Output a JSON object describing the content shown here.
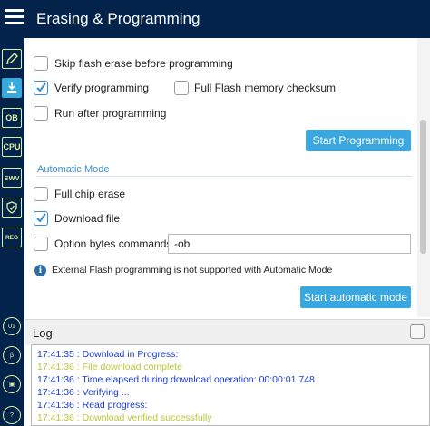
{
  "header": {
    "title": "Erasing & Programming"
  },
  "sidebar": {
    "buttons": [
      {
        "name": "edit",
        "label": ""
      },
      {
        "name": "download",
        "label": ""
      },
      {
        "name": "ob",
        "label": "OB"
      },
      {
        "name": "cpu",
        "label": "CPU"
      },
      {
        "name": "swv",
        "label": "SWV"
      },
      {
        "name": "security",
        "label": ""
      },
      {
        "name": "reg",
        "label": "REG"
      }
    ]
  },
  "options": {
    "skip_flash_erase": {
      "label": "Skip flash erase before programming",
      "checked": false
    },
    "verify_programming": {
      "label": "Verify programming",
      "checked": true
    },
    "full_flash_checksum": {
      "label": "Full Flash memory checksum",
      "checked": false
    },
    "run_after_programming": {
      "label": "Run after programming",
      "checked": false
    },
    "start_programming": "Start Programming"
  },
  "automatic_mode": {
    "title": "Automatic Mode",
    "full_chip_erase": {
      "label": "Full chip erase",
      "checked": false
    },
    "download_file": {
      "label": "Download file",
      "checked": true
    },
    "option_bytes": {
      "label": "Option bytes commands",
      "checked": false,
      "value": "-ob"
    },
    "info_text": "External Flash programming is not supported with Automatic Mode",
    "start_automatic": "Start automatic mode"
  },
  "log": {
    "title": "Log",
    "lines": [
      {
        "text": "17:41:35 : Download in Progress:",
        "color": "#1a3ccf"
      },
      {
        "text": "17:41:36 : File download complete",
        "color": "#b8c83a"
      },
      {
        "text": "17:41:36 : Time elapsed during download operation: 00:00:01.748",
        "color": "#1a3ccf"
      },
      {
        "text": "17:41:36 : Verifying ...",
        "color": "#1a3ccf"
      },
      {
        "text": "17:41:36 : Read progress:",
        "color": "#1a3ccf"
      },
      {
        "text": "17:41:36 : Download verified successfully",
        "color": "#b8c83a"
      }
    ]
  },
  "colors": {
    "topbar": "#03234b",
    "accent_button": "#3aa7e0",
    "checkbox_checked": "#3c8dd0",
    "sidebar_icon": "#d9f0a0"
  }
}
